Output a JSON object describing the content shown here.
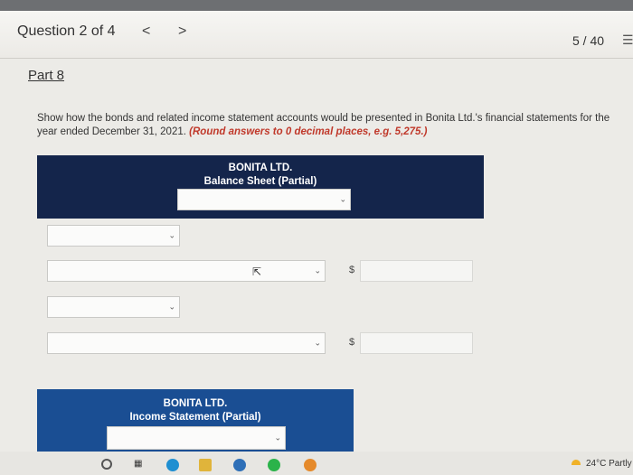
{
  "header": {
    "question_label": "Question 2 of 4",
    "prev_label": "<",
    "next_label": ">",
    "score": "5 / 40",
    "list_icon": "list-icon"
  },
  "part_label": "Part 8",
  "instructions": {
    "text": "Show how the bonds and related income statement accounts would be presented in Bonita Ltd.'s financial statements for the year ended December 31, 2021.",
    "round_note": "(Round answers to 0 decimal places, e.g. 5,275.)"
  },
  "balance_sheet": {
    "company": "BONITA LTD.",
    "title": "Balance Sheet (Partial)",
    "date_select_value": "",
    "rows": [
      {
        "account": "",
        "amount": ""
      },
      {
        "account": "",
        "amount": "",
        "currency": "$"
      },
      {
        "account": "",
        "amount": ""
      },
      {
        "account": "",
        "amount": "",
        "currency": "$"
      }
    ]
  },
  "income_statement": {
    "company": "BONITA LTD.",
    "title": "Income Statement (Partial)",
    "date_select_value": ""
  },
  "taskbar": {
    "weather": "24°C  Partly"
  },
  "colors": {
    "panel": "#14254b",
    "panel2": "#1a4e93",
    "round_note": "#c0392b"
  }
}
